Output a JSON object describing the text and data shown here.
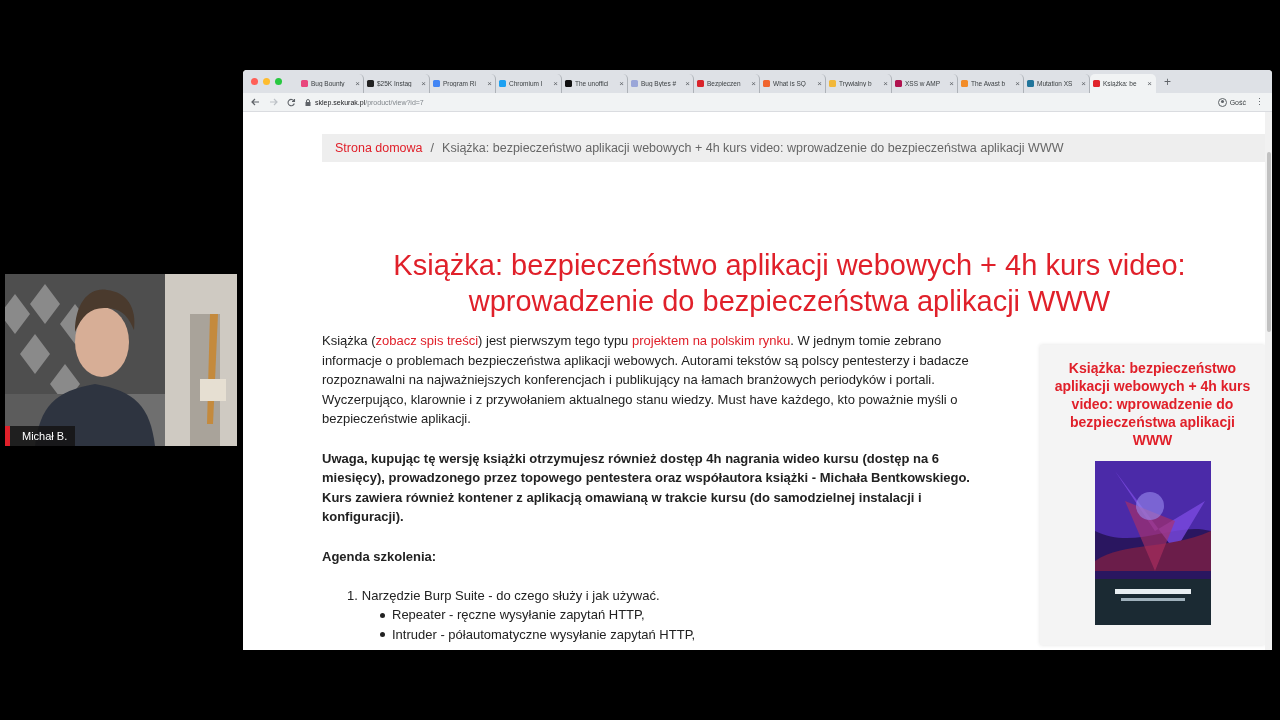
{
  "video_tile": {
    "participant_name": "Michał B."
  },
  "browser": {
    "tabs": [
      {
        "label": "Bug Bounty",
        "color": "#e8467c",
        "close": "×",
        "selected": false
      },
      {
        "label": "$25K Instag",
        "color": "#222222",
        "close": "×",
        "selected": false
      },
      {
        "label": "Program Ri",
        "color": "#4285f4",
        "close": "×",
        "selected": false
      },
      {
        "label": "Chromium I",
        "color": "#1da1f2",
        "close": "×",
        "selected": false
      },
      {
        "label": "The unoffici",
        "color": "#111111",
        "close": "×",
        "selected": false
      },
      {
        "label": "Bug Bytes #",
        "color": "#9aa6d8",
        "close": "×",
        "selected": false
      },
      {
        "label": "Bezpieczen",
        "color": "#d9242b",
        "close": "×",
        "selected": false
      },
      {
        "label": "What is SQ",
        "color": "#f0652f",
        "close": "×",
        "selected": false
      },
      {
        "label": "Trywialny b",
        "color": "#f2b83a",
        "close": "×",
        "selected": false
      },
      {
        "label": "XSS w AMP",
        "color": "#b0134f",
        "close": "×",
        "selected": false
      },
      {
        "label": "The Avast b",
        "color": "#f28c28",
        "close": "×",
        "selected": false
      },
      {
        "label": "Mutation XS",
        "color": "#21759b",
        "close": "×",
        "selected": false
      },
      {
        "label": "Książka: be",
        "color": "#e0242b",
        "close": "×",
        "selected": true
      }
    ],
    "new_tab": "+",
    "address": {
      "domain": "sklep.sekurak.pl",
      "path": "/product/view?id=7"
    },
    "profile": "Gość",
    "menu": "⋮"
  },
  "page": {
    "breadcrumb": [
      {
        "label": "Strona domowa",
        "kind": "link"
      },
      {
        "label": "Książka: bezpieczeństwo aplikacji webowych + 4h kurs video: wprowadzenie do bezpieczeństwa aplikacji WWW",
        "kind": "current"
      }
    ],
    "breadcrumb_separator": "/",
    "title": "Książka: bezpieczeństwo aplikacji webowych + 4h kurs video: wprowadzenie do bezpieczeństwa aplikacji WWW",
    "content": [
      {
        "kind": "paragraph",
        "parts": [
          {
            "kind": "text",
            "text": "Książka ("
          },
          {
            "kind": "link",
            "text": "zobacz spis treści"
          },
          {
            "kind": "text",
            "text": ") jest pierwszym tego typu "
          },
          {
            "kind": "link",
            "text": "projektem na polskim rynku"
          },
          {
            "kind": "text",
            "text": ". W jednym tomie zebrano informacje o problemach bezpieczeństwa aplikacji webowych. Autorami tekstów są polscy pentesterzy i badacze rozpoznawalni na najważniejszych konferencjach i publikujący na łamach branżowych periodyków i portali. Wyczerpująco, klarownie i z przywołaniem aktualnego stanu wiedzy. Must have każdego, kto poważnie myśli o bezpieczeństwie aplikacji."
          }
        ]
      },
      {
        "kind": "bold",
        "text": "Uwaga, kupując tę wersję książki otrzymujesz również dostęp 4h nagrania wideo kursu (dostęp na 6 miesięcy), prowadzonego przez topowego pentestera oraz współautora książki - Michała Bentkowskiego. Kurs zawiera również kontener z aplikacją omawianą w trakcie kursu (do samodzielnej instalacji i konfiguracji)."
      },
      {
        "kind": "bold",
        "text": "Agenda szkolenia:"
      },
      {
        "kind": "list",
        "items": [
          {
            "number": "1.",
            "text": "Narzędzie Burp Suite - do czego służy i jak używać.",
            "children": [
              {
                "text": "Repeater - ręczne wysyłanie zapytań HTTP,"
              },
              {
                "text": "Intruder - półautomatyczne wysyłanie zapytań HTTP,"
              }
            ]
          }
        ]
      }
    ],
    "product_card": {
      "title": "Książka: bezpieczeństwo aplikacji webowych + 4h kurs video: wprowadzenie do bezpieczeństwa aplikacji WWW"
    }
  }
}
